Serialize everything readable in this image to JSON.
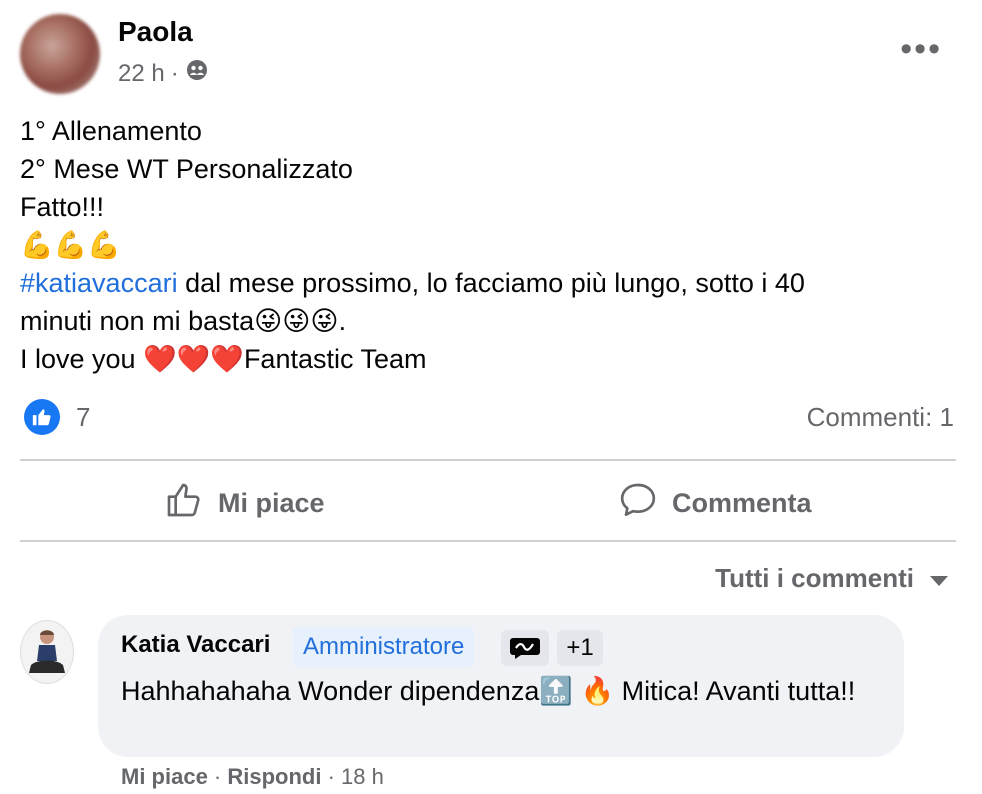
{
  "post": {
    "author": "Paola",
    "time": "22 h",
    "dot": "·",
    "more": "•••",
    "lines": [
      "1° Allenamento",
      "2° Mese WT Personalizzato",
      "Fatto!!!"
    ],
    "muscle_emoji": "💪💪💪",
    "hashtag": "#katiavaccari",
    "line_after_hashtag": " dal mese prossimo, lo facciamo più lungo, sotto i 40",
    "line_minuti": "minuti non mi basta",
    "winking_emojis": "😜😜😜",
    "period": ".",
    "love_prefix": "I love you ",
    "hearts": "❤️❤️❤️",
    "love_suffix": "Fantastic Team"
  },
  "reactions": {
    "like_count": "7",
    "comments_label": "Commenti: 1"
  },
  "actions": {
    "like_label": "Mi piace",
    "comment_label": "Commenta"
  },
  "comments_filter": "Tutti i commenti",
  "comment": {
    "author": "Katia Vaccari",
    "badge": "Amministratore",
    "plus": "+1",
    "text_part1": "Hahhahahaha Wonder dipendenza",
    "top_emoji": "🔝",
    "fire_emoji": "🔥",
    "text_part2": " Mitica! Avanti tutta!!",
    "like": "Mi piace",
    "reply": "Rispondi",
    "sep": " · ",
    "time": "18 h"
  },
  "icons": {
    "like_badge": "thumbs-up-icon",
    "audience": "friends-icon",
    "like_button": "thumbs-up-outline-icon",
    "comment_button": "speech-bubble-icon",
    "comment_badge": "conversation-starter-icon"
  },
  "colors": {
    "link_blue": "#216fdb",
    "like_blue": "#1877f2",
    "muted": "#65676b",
    "bubble": "#f0f2f5"
  }
}
